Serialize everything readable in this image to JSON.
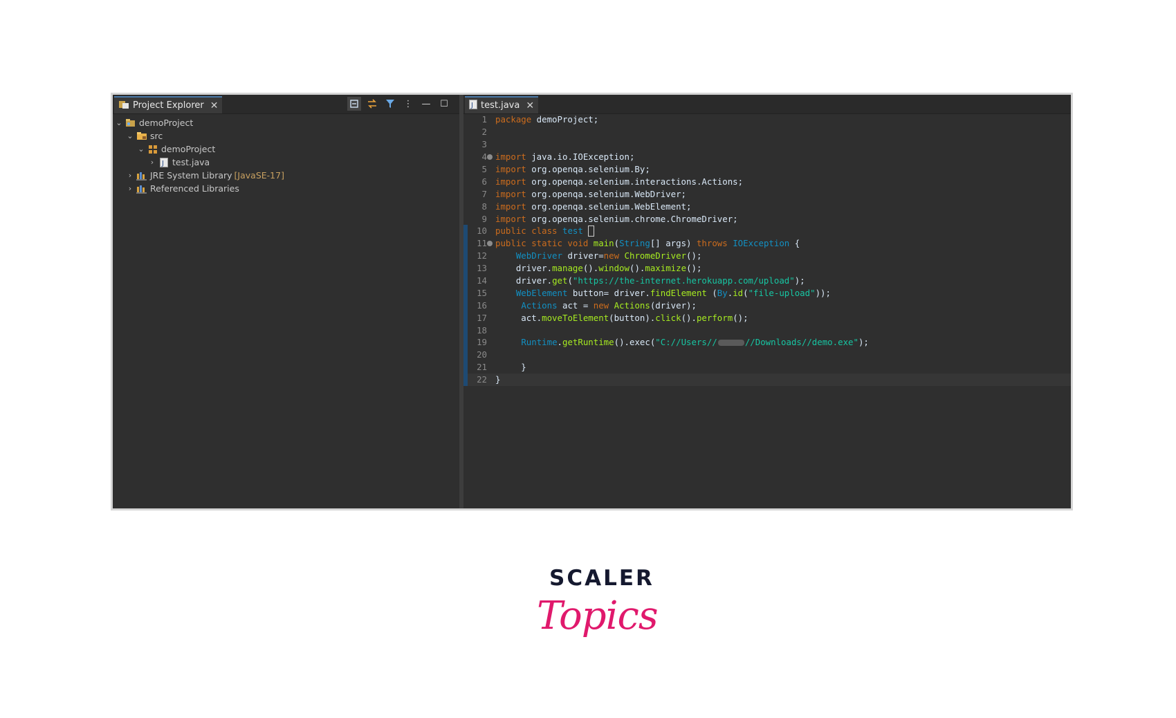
{
  "explorer": {
    "tab_label": "Project Explorer",
    "tree": [
      {
        "label": "demoProject",
        "chevron": "⌄",
        "icon": "project-icon",
        "level": 0
      },
      {
        "label": "src",
        "chevron": "⌄",
        "icon": "folder-icon",
        "level": 1
      },
      {
        "label": "demoProject",
        "chevron": "⌄",
        "icon": "package-icon",
        "level": 2
      },
      {
        "label": "test.java",
        "chevron": "›",
        "icon": "java-file-icon",
        "level": 3
      },
      {
        "label": "JRE System Library",
        "decoration": "[JavaSE-17]",
        "chevron": "›",
        "icon": "library-icon",
        "level": 1
      },
      {
        "label": "Referenced Libraries",
        "chevron": "›",
        "icon": "library-icon",
        "level": 1
      }
    ]
  },
  "editor": {
    "tab_label": "test.java",
    "lines": [
      {
        "n": "1",
        "tokens": [
          [
            "kw",
            "package"
          ],
          [
            "plain",
            " demoProject;"
          ]
        ]
      },
      {
        "n": "2",
        "tokens": []
      },
      {
        "n": "3",
        "tokens": []
      },
      {
        "n": "4",
        "fold": true,
        "tokens": [
          [
            "kw",
            "import"
          ],
          [
            "plain",
            " java.io.IOException;"
          ]
        ]
      },
      {
        "n": "5",
        "tokens": [
          [
            "kw",
            "import"
          ],
          [
            "plain",
            " org.openqa.selenium.By;"
          ]
        ]
      },
      {
        "n": "6",
        "tokens": [
          [
            "kw",
            "import"
          ],
          [
            "plain",
            " org.openqa.selenium.interactions.Actions;"
          ]
        ]
      },
      {
        "n": "7",
        "tokens": [
          [
            "kw",
            "import"
          ],
          [
            "plain",
            " org.openqa.selenium.WebDriver;"
          ]
        ]
      },
      {
        "n": "8",
        "tokens": [
          [
            "kw",
            "import"
          ],
          [
            "plain",
            " org.openqa.selenium.WebElement;"
          ]
        ]
      },
      {
        "n": "9",
        "tokens": [
          [
            "kw",
            "import"
          ],
          [
            "plain",
            " org.openqa.selenium.chrome.ChromeDriver;"
          ]
        ]
      },
      {
        "n": "10",
        "bar": true,
        "tokens": [
          [
            "kw",
            "public class"
          ],
          [
            "ty",
            " test "
          ],
          [
            "cursor",
            "{"
          ]
        ]
      },
      {
        "n": "11",
        "bar": true,
        "fold": true,
        "tokens": [
          [
            "kw",
            "public static void"
          ],
          [
            "fn",
            " main"
          ],
          [
            "plain",
            "("
          ],
          [
            "ty",
            "String"
          ],
          [
            "plain",
            "[] args) "
          ],
          [
            "kw",
            "throws"
          ],
          [
            "ty",
            " IOException"
          ],
          [
            "plain",
            " {"
          ]
        ]
      },
      {
        "n": "12",
        "bar": true,
        "tokens": [
          [
            "plain",
            "    "
          ],
          [
            "ty",
            "WebDriver"
          ],
          [
            "plain",
            " driver="
          ],
          [
            "kw",
            "new"
          ],
          [
            "fn",
            " ChromeDriver"
          ],
          [
            "plain",
            "();"
          ]
        ]
      },
      {
        "n": "13",
        "bar": true,
        "tokens": [
          [
            "plain",
            "    driver."
          ],
          [
            "fn",
            "manage"
          ],
          [
            "plain",
            "()."
          ],
          [
            "fn",
            "window"
          ],
          [
            "plain",
            "()."
          ],
          [
            "fn",
            "maximize"
          ],
          [
            "plain",
            "();"
          ]
        ]
      },
      {
        "n": "14",
        "bar": true,
        "tokens": [
          [
            "plain",
            "    driver."
          ],
          [
            "fn",
            "get"
          ],
          [
            "plain",
            "("
          ],
          [
            "str",
            "\"https://the-internet.herokuapp.com/upload\""
          ],
          [
            "plain",
            ");"
          ]
        ]
      },
      {
        "n": "15",
        "bar": true,
        "tokens": [
          [
            "plain",
            "    "
          ],
          [
            "ty",
            "WebElement"
          ],
          [
            "plain",
            " button= driver."
          ],
          [
            "fn",
            "findElement"
          ],
          [
            "plain",
            " ("
          ],
          [
            "ty",
            "By"
          ],
          [
            "plain",
            "."
          ],
          [
            "fn",
            "id"
          ],
          [
            "plain",
            "("
          ],
          [
            "str",
            "\"file-upload\""
          ],
          [
            "plain",
            "));"
          ]
        ]
      },
      {
        "n": "16",
        "bar": true,
        "tokens": [
          [
            "plain",
            "     "
          ],
          [
            "ty",
            "Actions"
          ],
          [
            "plain",
            " act = "
          ],
          [
            "kw",
            "new"
          ],
          [
            "fn",
            " Actions"
          ],
          [
            "plain",
            "(driver);"
          ]
        ]
      },
      {
        "n": "17",
        "bar": true,
        "tokens": [
          [
            "plain",
            "     act."
          ],
          [
            "fn",
            "moveToElement"
          ],
          [
            "plain",
            "(button)."
          ],
          [
            "fn",
            "click"
          ],
          [
            "plain",
            "()."
          ],
          [
            "fn",
            "perform"
          ],
          [
            "plain",
            "();"
          ]
        ]
      },
      {
        "n": "18",
        "bar": true,
        "tokens": []
      },
      {
        "n": "19",
        "bar": true,
        "tokens": [
          [
            "plain",
            "     "
          ],
          [
            "ty",
            "Runtime"
          ],
          [
            "plain",
            "."
          ],
          [
            "fn",
            "getRuntime"
          ],
          [
            "plain",
            "().exec("
          ],
          [
            "str",
            "\"C://Users//"
          ],
          [
            "blur",
            ""
          ],
          [
            "str",
            "//Downloads//demo.exe\""
          ],
          [
            "plain",
            ");"
          ]
        ]
      },
      {
        "n": "20",
        "bar": true,
        "tokens": []
      },
      {
        "n": "21",
        "bar": true,
        "tokens": [
          [
            "plain",
            "     }"
          ]
        ]
      },
      {
        "n": "22",
        "bar": true,
        "highlight": true,
        "tokens": [
          [
            "plain",
            "}"
          ]
        ]
      }
    ]
  },
  "logo": {
    "top": "SCALER",
    "bottom": "Topics"
  },
  "colors": {
    "keyword": "#cc6c1d",
    "type": "#1290c3",
    "method": "#a7ec21",
    "string": "#17c6a3",
    "brand_pink": "#e0196c",
    "brand_navy": "#15192f"
  }
}
